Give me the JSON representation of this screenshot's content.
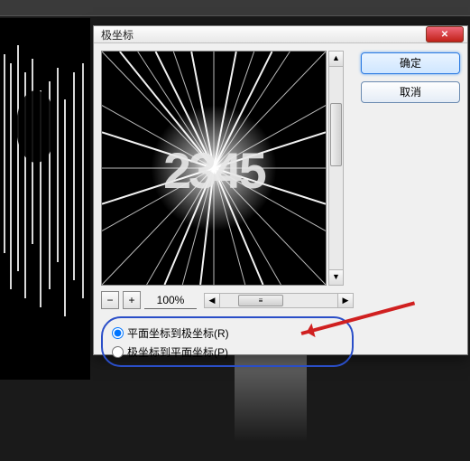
{
  "dialog": {
    "title": "极坐标",
    "ok_label": "确定",
    "cancel_label": "取消",
    "close_glyph": "✕"
  },
  "zoom": {
    "minus": "−",
    "plus": "+",
    "value": "100%"
  },
  "options": {
    "opt1": {
      "label": "平面坐标到极坐标(R)",
      "checked": true
    },
    "opt2": {
      "label": "极坐标到平面坐标(P)",
      "checked": false
    }
  },
  "scroll": {
    "up": "▲",
    "down": "▼",
    "left": "◀",
    "right": "▶",
    "grip": "≡"
  },
  "preview_text": "2345"
}
